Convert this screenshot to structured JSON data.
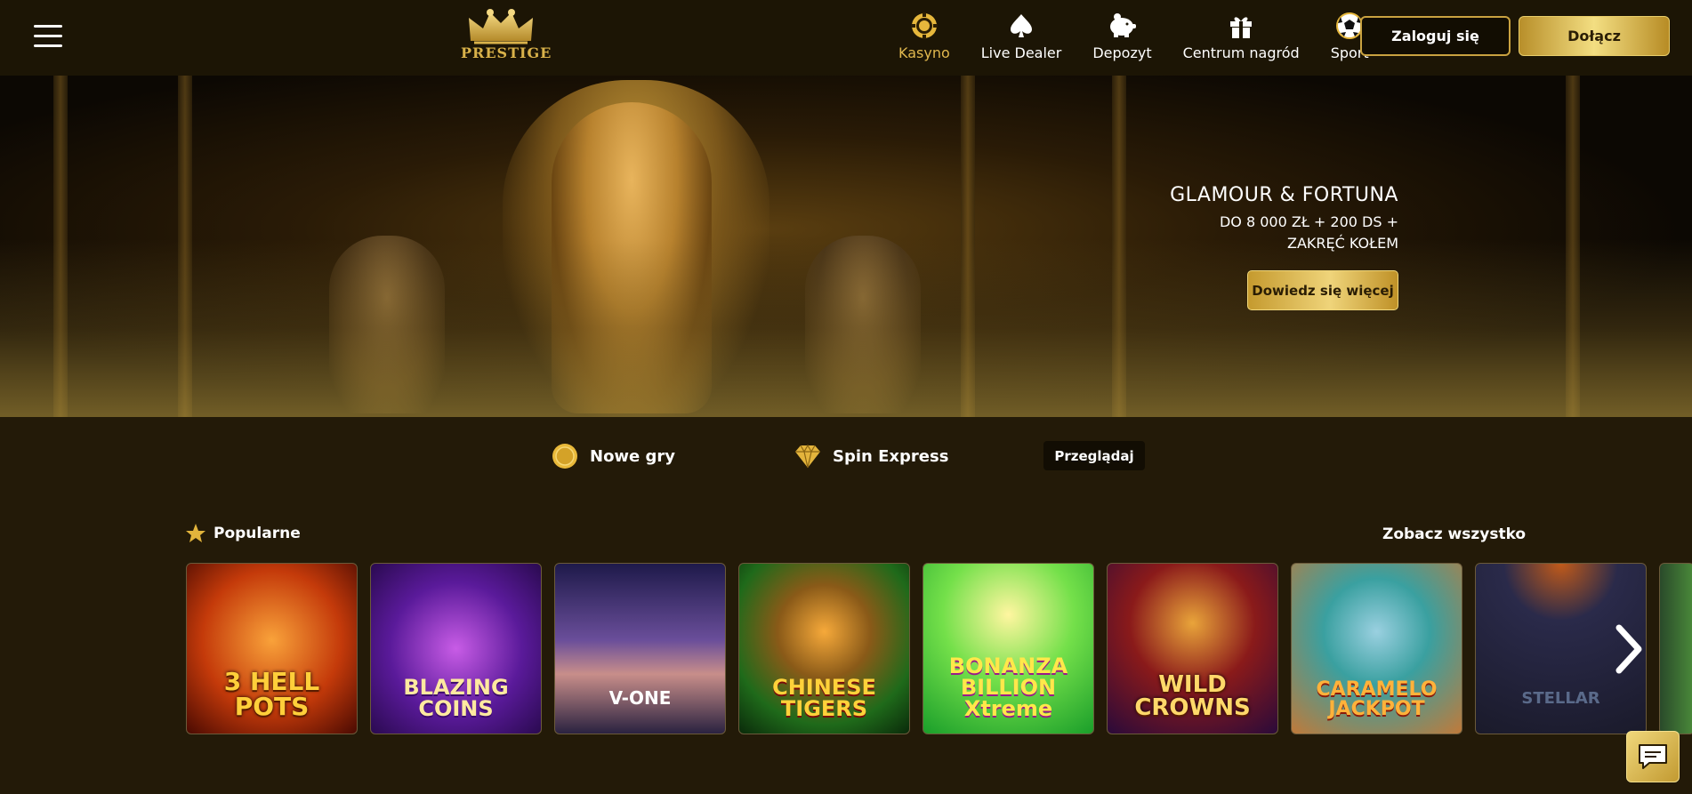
{
  "header": {
    "logo_text": "PRESTIGE",
    "nav": [
      {
        "label": "Kasyno",
        "icon": "casino-chip-icon",
        "active": true
      },
      {
        "label": "Live Dealer",
        "icon": "spade-icon",
        "active": false
      },
      {
        "label": "Depozyt",
        "icon": "piggy-bank-icon",
        "active": false
      },
      {
        "label": "Centrum nagród",
        "icon": "gift-icon",
        "active": false
      },
      {
        "label": "Sport",
        "icon": "soccer-ball-icon",
        "active": false
      }
    ],
    "login_label": "Zaloguj się",
    "join_label": "Dołącz"
  },
  "hero": {
    "title": "GLAMOUR & FORTUNA",
    "line1": "DO 8 000 ZŁ + 200 DS +",
    "line2": "ZAKRĘĆ KOŁEM",
    "button_label": "Dowiedz się więcej"
  },
  "categories": {
    "items": [
      {
        "label": "Nowe gry",
        "icon": "gold-coin-icon"
      },
      {
        "label": "Spin Express",
        "icon": "diamond-icon"
      }
    ],
    "browse_label": "Przeglądaj"
  },
  "popular": {
    "title": "Popularne",
    "see_all_label": "Zobacz wszystko",
    "games": [
      {
        "name": "3 HELL POTS"
      },
      {
        "name": "BLAZING COINS"
      },
      {
        "name": "V-ONE"
      },
      {
        "name": "CHINESE TIGERS"
      },
      {
        "name": "BONANZA BILLION Xtreme"
      },
      {
        "name": "WILD CROWNS"
      },
      {
        "name": "CARAMELO JACKPOT"
      },
      {
        "name": "STELLAR"
      }
    ]
  },
  "colors": {
    "accent_gold": "#e1b84e",
    "background": "#231a08",
    "header_bg": "#1c1505"
  }
}
